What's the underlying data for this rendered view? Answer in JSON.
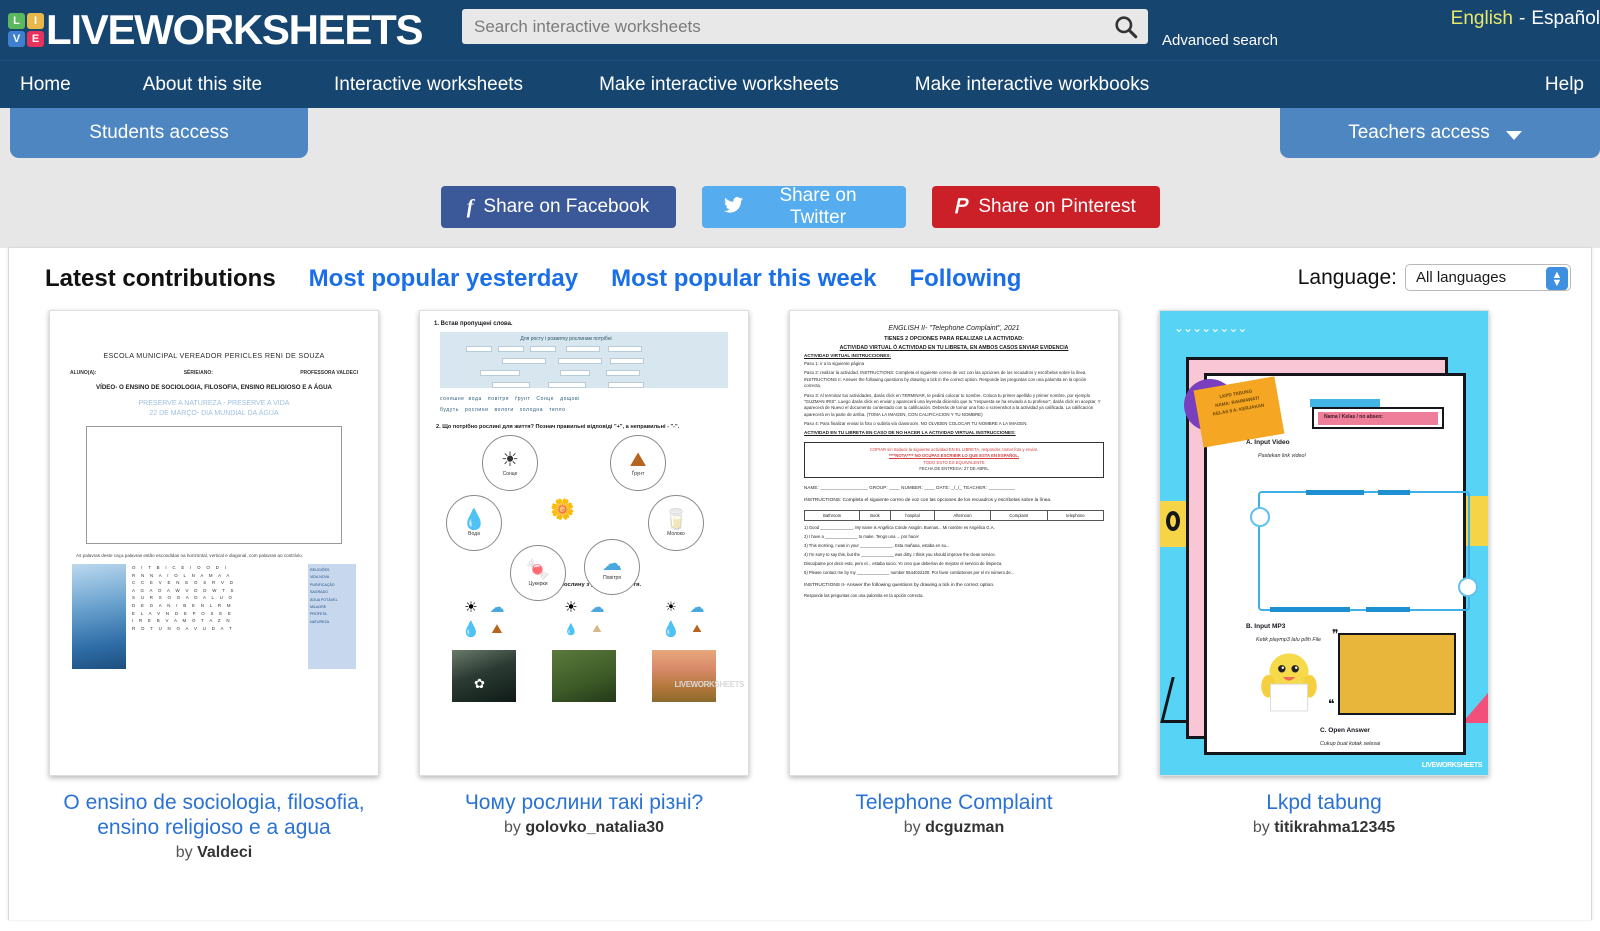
{
  "header": {
    "logo_letters": [
      "L",
      "I",
      "V",
      "E"
    ],
    "logo_colors": [
      "#5cb85c",
      "#e8b84b",
      "#3f7fd0",
      "#e8315c"
    ],
    "brand": "LIVEWORKSHEETS",
    "search_placeholder": "Search interactive worksheets",
    "search_value": "",
    "search_icon": "search-icon",
    "advanced_search": "Advanced search",
    "lang_english": "English",
    "lang_separator": "-",
    "lang_spanish": "Español"
  },
  "nav": {
    "items": [
      {
        "label": "Home"
      },
      {
        "label": "About this site"
      },
      {
        "label": "Interactive worksheets"
      },
      {
        "label": "Make interactive worksheets"
      },
      {
        "label": "Make interactive workbooks"
      },
      {
        "label": "Help"
      }
    ]
  },
  "access": {
    "students": "Students access",
    "teachers": "Teachers access"
  },
  "share": {
    "facebook": {
      "label": "Share on Facebook",
      "icon": "facebook-icon",
      "glyph": "f",
      "color": "#3b5998"
    },
    "twitter": {
      "label": "Share on Twitter",
      "icon": "twitter-icon",
      "glyph": "ᵗ",
      "color": "#55acee"
    },
    "pinterest": {
      "label": "Share on Pinterest",
      "icon": "pinterest-icon",
      "glyph": "ᵖ",
      "color": "#cb2027"
    }
  },
  "tabs": {
    "active": "Latest contributions",
    "items": [
      {
        "label": "Most popular yesterday"
      },
      {
        "label": "Most popular this week"
      },
      {
        "label": "Following"
      }
    ]
  },
  "language_filter": {
    "label": "Language:",
    "value": "All languages"
  },
  "cards": [
    {
      "title": "O ensino de sociologia, filosofia, ensino religioso e a agua",
      "by": "by",
      "author": "Valdeci",
      "thumb": {
        "school": "ESCOLA MUNICIPAL VEREADOR PERICLES RENI DE SOUZA",
        "student_label": "ALUNO(A):",
        "series_label": "SÉRIE/ANO:",
        "teacher_label": "PROFESSORA VALDECI",
        "heading": "VÍDEO- O ENSINO DE SOCIOLOGIA, FILOSOFIA, ENSINO RELIGIOSO E A ÁGUA",
        "blue_line1": "PRESERVE A NATUREZA - PRESERVE A VIDA",
        "blue_line2": "22 DE MARÇO- DIA MUNDIAL DA ÁGUA",
        "note": "As palavras deste caça palavras estão escondidas na horizontal, vertical e diagonal, com palavras ao contrário.",
        "word_rows": [
          "O I T B I C E I O O D I",
          "R N N A I O L N A M A A",
          "C C E V E N E O S R V D",
          "A G A O A W V D D W T S",
          "S U R S O G A D A L U O",
          "D E G A N I B E N L R M",
          "E L A V N D E P O S E E",
          "I R E B V A M O T A Z N",
          "R O T U N O A V U D A T"
        ],
        "word_list": [
          "RELIGIÕES",
          "VIDA NOVA",
          "PURIFICAÇÃO",
          "SAGRADO",
          "ÁGUA POTÁVEL",
          "MILAGRE",
          "PROFETA",
          "NATUREZA"
        ]
      }
    },
    {
      "title": "Чому рослини такі різні?",
      "by": "by",
      "author": "golovko_natalia30",
      "thumb": {
        "q1": "1.  Встав пропущені слова.",
        "fill_text": "Для росту і розвитку рослинам потрібні",
        "words": [
          "соняшне",
          "вода",
          "повітря",
          "ґрунт",
          "Сонце",
          "дощові",
          "будуть",
          "рослини",
          "вологи",
          "холодна",
          "тепло"
        ],
        "q2": "2.  Що потрібно рослині для життя? Познач правильні відповіді \"+\", а неправильні - \"-\".",
        "circles": [
          "Сонце",
          "Ґрунт",
          "Вода",
          "Молоко",
          "Цукерки",
          "Повітря"
        ],
        "q3": "3.  Відгадай рослину з умовами її життя.",
        "watermark": "LIVEWORKSHEETS"
      }
    },
    {
      "title": "Telephone Complaint",
      "by": "by",
      "author": "dcguzman",
      "thumb": {
        "title": "ENGLISH II- \"Telephone Complaint\", 2021",
        "line1": "TIENES 2 OPCIONES PARA REALIZAR LA ACTIVIDAD:",
        "line2": "ACTIVIDAD VIRTUAL Ó ACTIVIDAD EN TU LIBRETA, EN AMBOS CASOS ENVIAR EVIDENCIA",
        "line3": "ACTIVIDAD VIRTUAL INSTRUCCIONES:",
        "steps": [
          "Paso 1: ir a la siguiente página",
          "Paso 2: realizar la actividad. INSTRUCTIONS: Completa el siguiente correo de voz con las opciones de los recuadros y escríbelas sobre la línea. INSTRUCTIONS II: Answer the following questions by drawing a tick in the correct option. Responde las preguntas con una palomita en la opción correcta.",
          "Paso 3: Al terminar tus actividades, darás click en TERMINAR, te pedirá colocar tu nombre. Coloca tu primer apellido y primer nombre, por ejemplo \"GUZMAN IRIS\". Luego darás click en enviar y aparecerá una leyenda diciendo que tu \"respuesta se ha enviado a tu profesor\", darás click en aceptar. Y aparecerá de Nuevo el documento contestado con tu calificación. Deberás de tomar una foto o screenshot a la actividad ya calificada. La calificación aparecerá en la parte de arriba. (TOMA LA IMAGEN, CON CALIFICACION Y TU NOMBRE)",
          "Paso 4: Para finalizar enviar la foto o subirla vía classroom. NO OLVIDEN COLOCAR TU NOMBRE A LA IMAGEN."
        ],
        "alt_heading": "ACTIVIDAD EN TU LIBRETA EN CASO DE NO HACER LA ACTIVIDAD VIRTUAL INSTRUCCIONES:",
        "redbox": [
          "COPIAR sin traducir la siguiente actividad EN EL LIBRETA, responder, tomar foto y enviar.",
          "****NOTA**** NO OCUPAS ESCRIBIR LO QUE ESTA EN ESPAÑOL.",
          "TODO ESTO ES EQUIVALENTE",
          "FECHA DE ENTREGA: 27 DE ABRIL"
        ],
        "field_line": "NAME: __________________ GROUP: ____ NUMBER: ____ DATE: _/_/_ TEACHER: __________",
        "instructions": "INSTRUCTIONS: Completa el siguiente correo de voz con las opciones de los recuadros y escríbelas sobre la línea.",
        "table_row": [
          "Bathroom",
          "Book",
          "hospital",
          "Afternoon",
          "Complaint",
          "telephone"
        ],
        "questions": [
          "1) Good ______________.  My name is Angélica Conde Aragón.  Buenas...  Mi nombre es Angélica G.A.",
          "2) I have a ______________  to make.  Tengo una ... por hacer",
          "3) This morning, I was in your ______________.  Esta mañana, estaba en su...",
          "4) I'm sorry to say this, but the ______________ was dirty.  I think you should improve the clean service.",
          "Disculpame por decir esto, pero el... estaba sucio. Yo creo que deberían de mejorar el servicio de limpieza.",
          "5) Please contact me by my ______________ number 5544022100.  Por favor contáctenos por el mi número de..."
        ],
        "instructions2": "INSTRUCTIONS II- Answer the following questions by drawing a tick in the correct option.",
        "instructions2_es": "Responde las preguntas con una palomita en la opción correcta."
      }
    },
    {
      "title": "Lkpd tabung",
      "by": "by",
      "author": "titikrahma12345",
      "thumb": {
        "sticky": [
          "LKPD TABUNG",
          "NAMA: RAHMAWATI",
          "KELAS 9 A: KERJAKAN"
        ],
        "name_field": "Nama / Kelas / no absen:",
        "section_a": "A. Input Video",
        "section_a_sub": "Pastekan link video!",
        "section_b": "B. Input MP3",
        "section_b_sub": "Ketik playmp3 lalu pilih File",
        "section_c": "C. Open Answer",
        "section_c_sub": "Cukup buat kotak selesai",
        "watermark": "LIVEWORKSHEETS"
      }
    }
  ]
}
